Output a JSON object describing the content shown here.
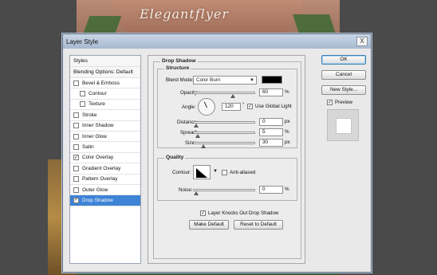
{
  "background": {
    "title_text": "Elegantflyer"
  },
  "dialog": {
    "title": "Layer Style",
    "close_label": "X",
    "left_list": {
      "items": [
        {
          "label": "Styles",
          "type": "header"
        },
        {
          "label": "Blending Options: Default",
          "type": "header"
        },
        {
          "label": "Bevel & Emboss",
          "checked": false,
          "indent": false
        },
        {
          "label": "Contour",
          "checked": false,
          "indent": true
        },
        {
          "label": "Texture",
          "checked": false,
          "indent": true
        },
        {
          "label": "Stroke",
          "checked": false,
          "indent": false
        },
        {
          "label": "Inner Shadow",
          "checked": false,
          "indent": false
        },
        {
          "label": "Inner Glow",
          "checked": false,
          "indent": false
        },
        {
          "label": "Satin",
          "checked": false,
          "indent": false
        },
        {
          "label": "Color Overlay",
          "checked": true,
          "indent": false
        },
        {
          "label": "Gradient Overlay",
          "checked": false,
          "indent": false
        },
        {
          "label": "Pattern Overlay",
          "checked": false,
          "indent": false
        },
        {
          "label": "Outer Glow",
          "checked": false,
          "indent": false
        },
        {
          "label": "Drop Shadow",
          "checked": true,
          "indent": false,
          "selected": true
        }
      ]
    },
    "drop_shadow": {
      "title": "Drop Shadow",
      "structure_title": "Structure",
      "blend_mode_label": "Blend Mode:",
      "blend_mode_value": "Color Burn",
      "shadow_color": "#000000",
      "opacity_label": "Opacity:",
      "opacity_value": "60",
      "opacity_unit": "%",
      "opacity_slider": 0.6,
      "angle_label": "Angle:",
      "angle_value": "120",
      "angle_unit": "°",
      "use_global_light_label": "Use Global Light",
      "use_global_light_checked": true,
      "distance_label": "Distance:",
      "distance_value": "0",
      "distance_unit": "px",
      "distance_slider": 0.0,
      "spread_label": "Spread:",
      "spread_value": "5",
      "spread_unit": "%",
      "spread_slider": 0.05,
      "size_label": "Size:",
      "size_value": "30",
      "size_unit": "px",
      "size_slider": 0.12
    },
    "quality": {
      "title": "Quality",
      "contour_label": "Contour:",
      "anti_aliased_label": "Anti-aliased",
      "anti_aliased_checked": false,
      "noise_label": "Noise:",
      "noise_value": "0",
      "noise_unit": "%",
      "noise_slider": 0.0
    },
    "knockout_label": "Layer Knocks Out Drop Shadow",
    "knockout_checked": true,
    "make_default_label": "Make Default",
    "reset_default_label": "Reset to Default",
    "buttons": {
      "ok": "OK",
      "cancel": "Cancel",
      "new_style": "New Style..."
    },
    "preview_label": "Preview",
    "preview_checked": true
  }
}
